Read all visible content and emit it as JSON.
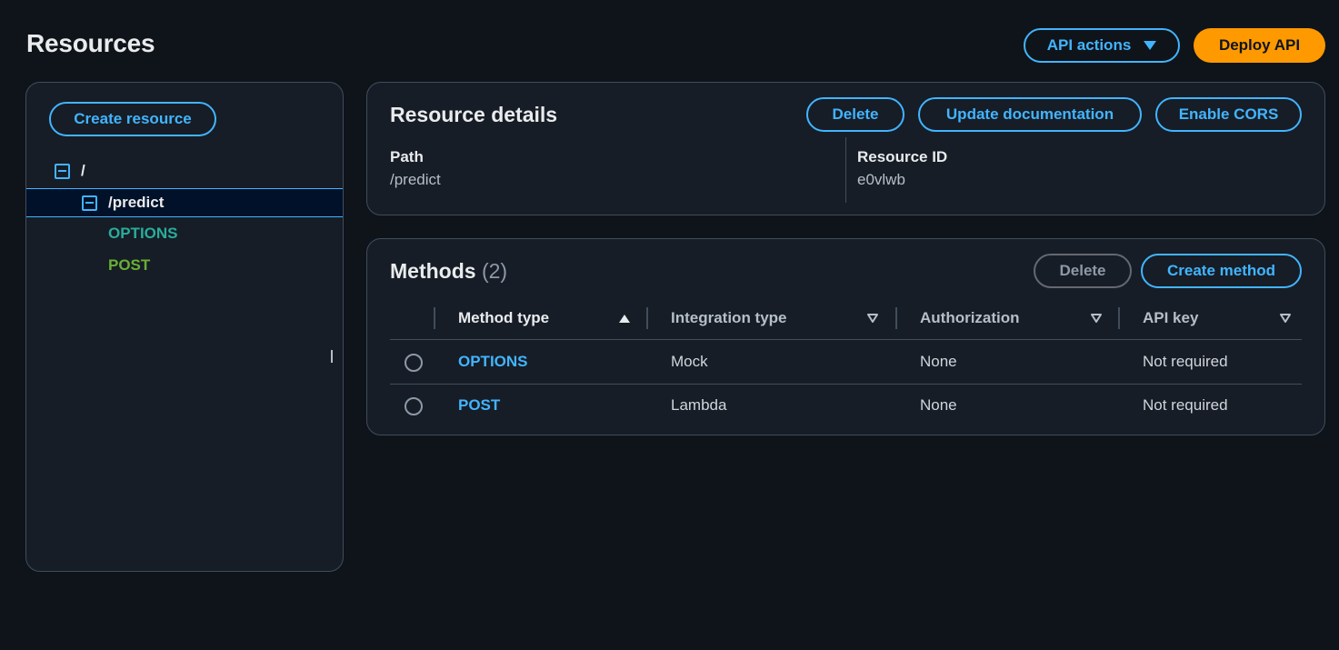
{
  "page": {
    "title": "Resources",
    "api_actions_label": "API actions",
    "deploy_label": "Deploy API"
  },
  "tree": {
    "create_resource_label": "Create resource",
    "root_label": "/",
    "child_label": "/predict",
    "methods": [
      "OPTIONS",
      "POST"
    ]
  },
  "resource_details": {
    "title": "Resource details",
    "delete_label": "Delete",
    "update_doc_label": "Update documentation",
    "enable_cors_label": "Enable CORS",
    "path_label": "Path",
    "path_value": "/predict",
    "resource_id_label": "Resource ID",
    "resource_id_value": "e0vlwb"
  },
  "methods": {
    "title": "Methods",
    "count": "(2)",
    "delete_label": "Delete",
    "create_label": "Create method",
    "columns": [
      "Method type",
      "Integration type",
      "Authorization",
      "API key"
    ],
    "sorted_column": "Method type",
    "sort_direction": "ascending",
    "rows": [
      {
        "method": "OPTIONS",
        "integration": "Mock",
        "authorization": "None",
        "api_key": "Not required"
      },
      {
        "method": "POST",
        "integration": "Lambda",
        "authorization": "None",
        "api_key": "Not required"
      }
    ]
  },
  "colors": {
    "accent": "#42b4ff",
    "primary": "#ff9900",
    "options_method": "#29ad9c",
    "post_method": "#6aaf35"
  }
}
